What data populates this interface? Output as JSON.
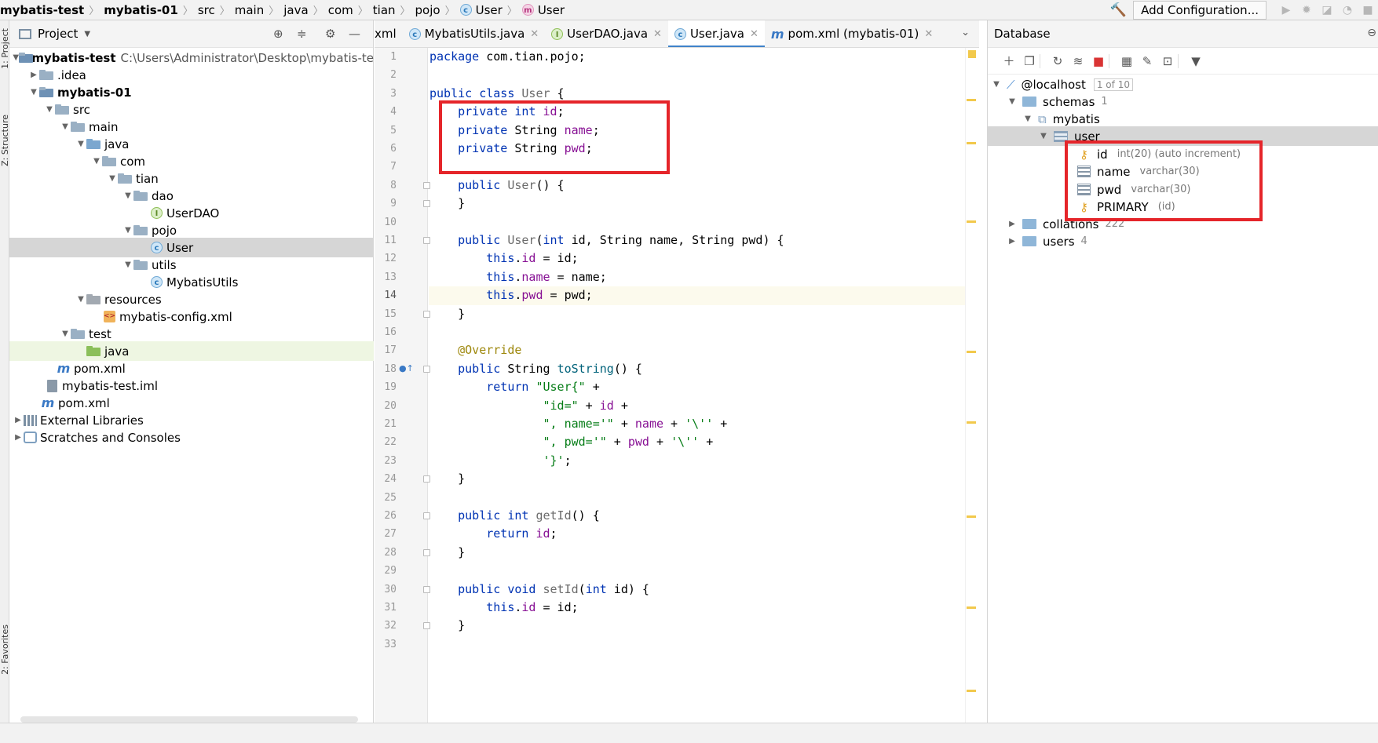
{
  "breadcrumb": {
    "items": [
      "mybatis-test",
      "mybatis-01",
      "src",
      "main",
      "java",
      "com",
      "tian",
      "pojo",
      "User",
      "User"
    ]
  },
  "toolbar": {
    "add_configuration": "Add Configuration...",
    "icons": [
      "hammer-icon",
      "run-icon",
      "debug-icon",
      "coverage-icon",
      "profile-icon"
    ]
  },
  "side_tabs": {
    "project": "1: Project",
    "structure": "Z: Structure",
    "favorites": "2: Favorites"
  },
  "project_panel": {
    "title": "Project",
    "tree": [
      {
        "label": "mybatis-test",
        "path": "C:\\Users\\Administrator\\Desktop\\mybatis-te",
        "bold": true
      },
      {
        "label": ".idea"
      },
      {
        "label": "mybatis-01",
        "bold": true
      },
      {
        "label": "src"
      },
      {
        "label": "main"
      },
      {
        "label": "java"
      },
      {
        "label": "com"
      },
      {
        "label": "tian"
      },
      {
        "label": "dao"
      },
      {
        "label": "UserDAO",
        "badge": "I"
      },
      {
        "label": "pojo"
      },
      {
        "label": "User",
        "badge": "C"
      },
      {
        "label": "utils"
      },
      {
        "label": "MybatisUtils",
        "badge": "C"
      },
      {
        "label": "resources"
      },
      {
        "label": "mybatis-config.xml"
      },
      {
        "label": "test"
      },
      {
        "label": "java"
      },
      {
        "label": "pom.xml",
        "badge": "m"
      },
      {
        "label": "mybatis-test.iml"
      },
      {
        "label": "pom.xml",
        "badge": "m"
      },
      {
        "label": "External Libraries"
      },
      {
        "label": "Scratches and Consoles"
      }
    ]
  },
  "editor": {
    "tabs": [
      {
        "label": "xml",
        "badge": ""
      },
      {
        "label": "MybatisUtils.java",
        "badge": "C"
      },
      {
        "label": "UserDAO.java",
        "badge": "I"
      },
      {
        "label": "User.java",
        "badge": "C",
        "active": true
      },
      {
        "label": "pom.xml (mybatis-01)",
        "badge": "m"
      }
    ],
    "line_numbers": [
      "1",
      "2",
      "3",
      "4",
      "5",
      "6",
      "7",
      "8",
      "9",
      "10",
      "11",
      "12",
      "13",
      "14",
      "15",
      "16",
      "17",
      "18",
      "19",
      "20",
      "21",
      "22",
      "23",
      "24",
      "25",
      "26",
      "27",
      "28",
      "29",
      "30",
      "31",
      "32",
      "33"
    ],
    "current_line": 14
  },
  "database_panel": {
    "title": "Database",
    "host": "@localhost",
    "host_count": "1 of 10",
    "schemas_label": "schemas",
    "schemas_count": "1",
    "schema": "mybatis",
    "table": "user",
    "columns": [
      {
        "name": "id",
        "type": "int(20) (auto increment)"
      },
      {
        "name": "name",
        "type": "varchar(30)"
      },
      {
        "name": "pwd",
        "type": "varchar(30)"
      },
      {
        "name": "PRIMARY",
        "type": "(id)"
      }
    ],
    "collations_label": "collations",
    "collations_count": "222",
    "users_label": "users",
    "users_count": "4"
  },
  "highlight_color": "#e5252a"
}
